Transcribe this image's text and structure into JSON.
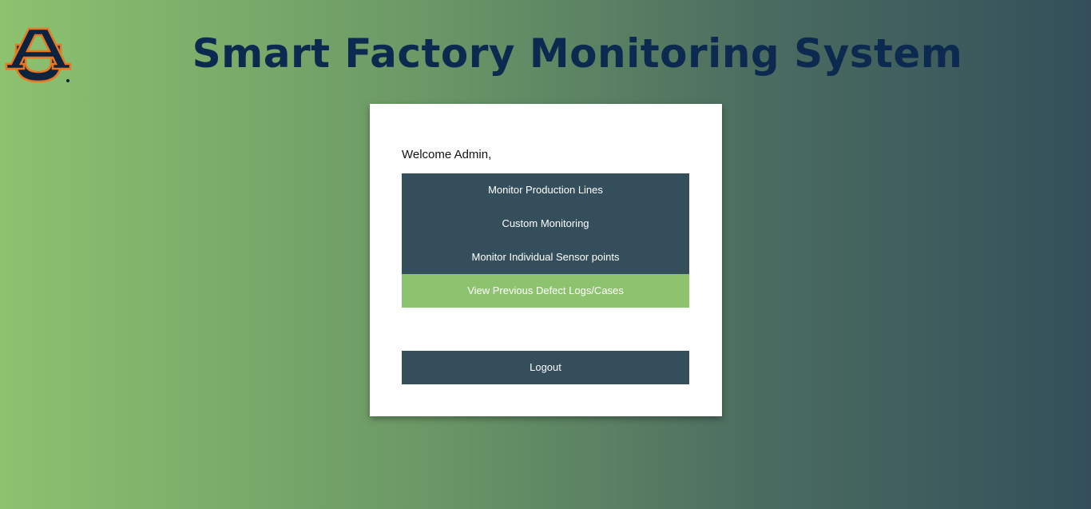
{
  "header": {
    "title": "Smart Factory Monitoring System",
    "logo_text": "AU"
  },
  "card": {
    "welcome": "Welcome Admin,",
    "menu": [
      {
        "label": "Monitor Production Lines",
        "active": false
      },
      {
        "label": "Custom Monitoring",
        "active": false
      },
      {
        "label": "Monitor Individual Sensor points",
        "active": false
      },
      {
        "label": "View Previous Defect Logs/Cases",
        "active": true
      }
    ],
    "logout_label": "Logout"
  },
  "colors": {
    "title": "#0c2a4f",
    "button": "#354e5b",
    "button_active": "#8dc26f",
    "logo_orange": "#e87722",
    "logo_navy": "#0c2340"
  }
}
